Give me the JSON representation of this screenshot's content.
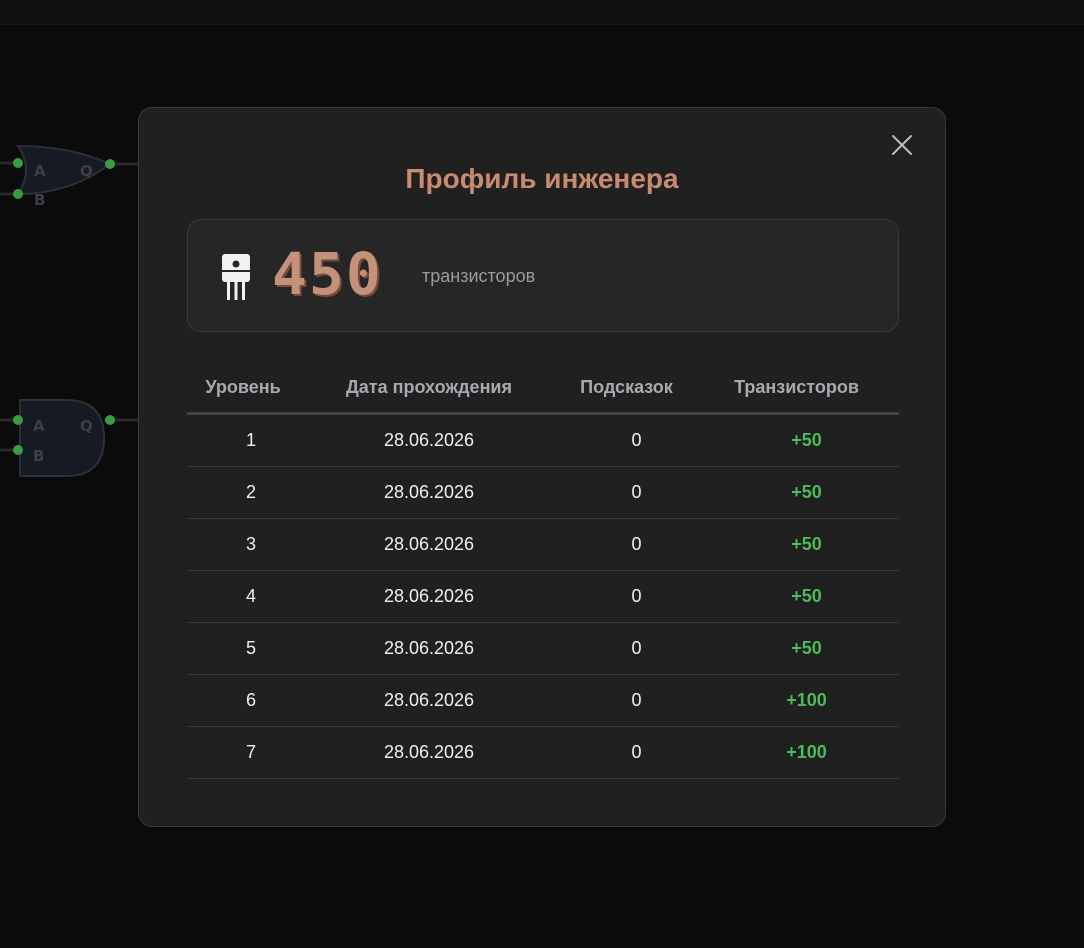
{
  "modal": {
    "title": "Профиль инженера",
    "balance": {
      "value": "450",
      "unit": "транзисторов"
    }
  },
  "table": {
    "headers": [
      "Уровень",
      "Дата прохождения",
      "Подсказок",
      "Транзисторов"
    ],
    "rows": [
      {
        "level": "1",
        "date": "28.06.2026",
        "hints": "0",
        "reward": "+50"
      },
      {
        "level": "2",
        "date": "28.06.2026",
        "hints": "0",
        "reward": "+50"
      },
      {
        "level": "3",
        "date": "28.06.2026",
        "hints": "0",
        "reward": "+50"
      },
      {
        "level": "4",
        "date": "28.06.2026",
        "hints": "0",
        "reward": "+50"
      },
      {
        "level": "5",
        "date": "28.06.2026",
        "hints": "0",
        "reward": "+50"
      },
      {
        "level": "6",
        "date": "28.06.2026",
        "hints": "0",
        "reward": "+100"
      },
      {
        "level": "7",
        "date": "28.06.2026",
        "hints": "0",
        "reward": "+100"
      }
    ]
  },
  "background": {
    "gates": [
      {
        "input_a": "A",
        "input_b": "B",
        "output": "Q"
      },
      {
        "input_a": "A",
        "input_b": "B",
        "output": "Q"
      }
    ]
  },
  "colors": {
    "title": "#c98a72",
    "balance": "#c4917a",
    "reward": "#4cbb5a",
    "modal_bg": "#202020"
  },
  "icons": {
    "close": "close-icon",
    "balance": "transistor-icon"
  }
}
